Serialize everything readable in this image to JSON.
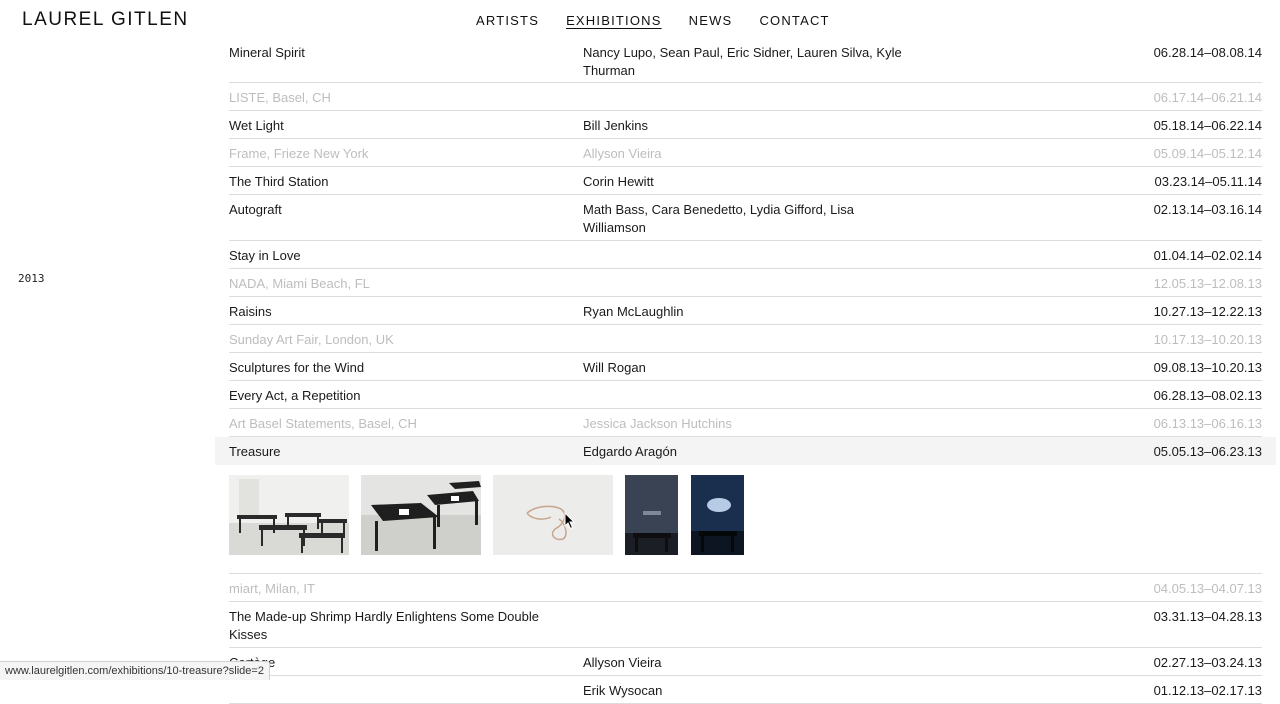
{
  "site": {
    "title": "LAUREL GITLEN"
  },
  "nav": [
    {
      "label": "ARTISTS",
      "active": false
    },
    {
      "label": "EXHIBITIONS",
      "active": true
    },
    {
      "label": "NEWS",
      "active": false
    },
    {
      "label": "CONTACT",
      "active": false
    }
  ],
  "year_label": "2013",
  "exhibitions": [
    {
      "title": "Mineral Spirit",
      "artists": "Nancy Lupo, Sean Paul, Eric Sidner, Lauren Silva, Kyle Thurman",
      "dates": "06.28.14–08.08.14",
      "dim": false
    },
    {
      "title": "LISTE, Basel, CH",
      "artists": "",
      "dates": "06.17.14–06.21.14",
      "dim": true
    },
    {
      "title": "Wet Light",
      "artists": "Bill Jenkins",
      "dates": "05.18.14–06.22.14",
      "dim": false
    },
    {
      "title": "Frame, Frieze New York",
      "artists": "Allyson Vieira",
      "dates": "05.09.14–05.12.14",
      "dim": true
    },
    {
      "title": "The Third Station",
      "artists": "Corin Hewitt",
      "dates": "03.23.14–05.11.14",
      "dim": false
    },
    {
      "title": "Autograft",
      "artists": "Math Bass, Cara Benedetto, Lydia Gifford, Lisa Williamson",
      "dates": "02.13.14–03.16.14",
      "dim": false
    },
    {
      "title": "Stay in Love",
      "artists": "",
      "dates": "01.04.14–02.02.14",
      "dim": false
    },
    {
      "title": "NADA, Miami Beach, FL",
      "artists": "",
      "dates": "12.05.13–12.08.13",
      "dim": true
    },
    {
      "title": "Raisins",
      "artists": "Ryan McLaughlin",
      "dates": "10.27.13–12.22.13",
      "dim": false
    },
    {
      "title": "Sunday Art Fair, London, UK",
      "artists": "",
      "dates": "10.17.13–10.20.13",
      "dim": true
    },
    {
      "title": "Sculptures for the Wind",
      "artists": "Will Rogan",
      "dates": "09.08.13–10.20.13",
      "dim": false
    },
    {
      "title": "Every Act, a Repetition",
      "artists": "",
      "dates": "06.28.13–08.02.13",
      "dim": false
    },
    {
      "title": "Art Basel Statements, Basel, CH",
      "artists": "Jessica Jackson Hutchins",
      "dates": "06.13.13–06.16.13",
      "dim": true
    },
    {
      "title": "Treasure",
      "artists": "Edgardo Aragón",
      "dates": "05.05.13–06.23.13",
      "dim": false,
      "selected": true
    },
    {
      "title": "miart, Milan, IT",
      "artists": "",
      "dates": "04.05.13–04.07.13",
      "dim": true
    },
    {
      "title": "The Made-up Shrimp Hardly Enlightens Some Double Kisses",
      "artists": "",
      "dates": "03.31.13–04.28.13",
      "dim": false
    },
    {
      "title": "Cortège",
      "artists": "Allyson Vieira",
      "dates": "02.27.13–03.24.13",
      "dim": false
    },
    {
      "title": "",
      "artists": "Erik Wysocan",
      "dates": "01.12.13–02.17.13",
      "dim": false
    }
  ],
  "gallery": {
    "thumbnails": [
      {
        "name": "gallery-tables-view-thumb"
      },
      {
        "name": "tables-closeup-thumb"
      },
      {
        "name": "necklace-object-thumb"
      },
      {
        "name": "dark-projection-thumb"
      },
      {
        "name": "blue-projection-thumb"
      }
    ]
  },
  "status_url": "www.laurelgitlen.com/exhibitions/10-treasure?slide=2",
  "colors": {
    "text": "#1a1a1a",
    "dim_text": "#bdbdbd",
    "rule": "#dcdcdc",
    "selected_bg": "#f4f4f4"
  }
}
